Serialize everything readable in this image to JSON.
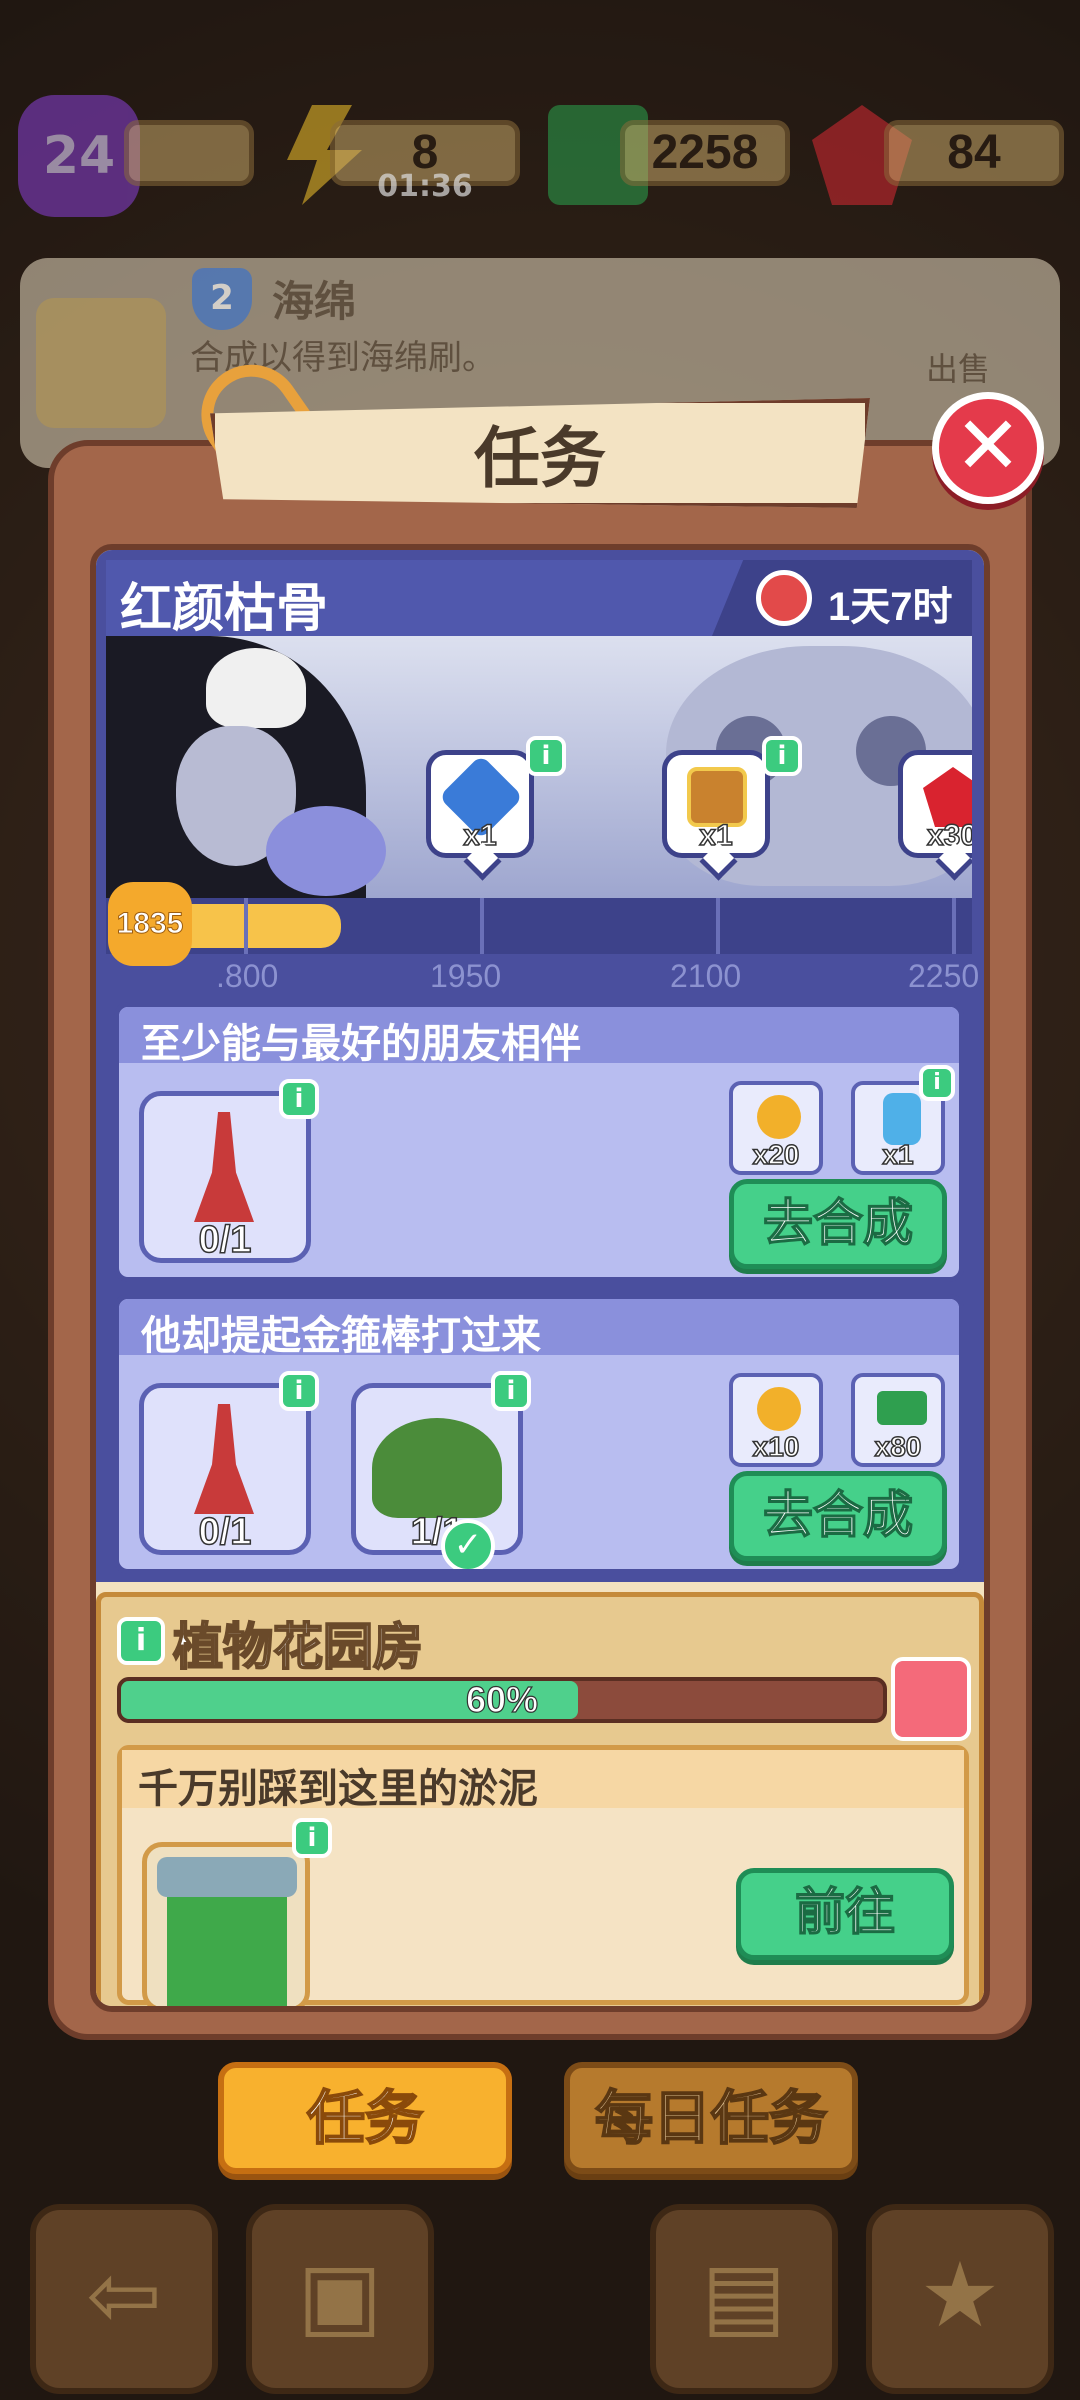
{
  "hud": {
    "level": "24",
    "energy": "8",
    "energy_timer": "01:36",
    "cash": "2258",
    "gems": "84"
  },
  "infocard": {
    "shield_level": "2",
    "item_name": "海绵",
    "description": "合成以得到海绵刷。",
    "sell_label": "出售"
  },
  "modal": {
    "title": "任务",
    "close_glyph": "✕",
    "event": {
      "name": "红颜枯骨",
      "timer": "1天7时",
      "progress": {
        "current_label": "1835",
        "current_value": 1835,
        "ticks": [
          ".800",
          "1950",
          "2100",
          "2250"
        ],
        "rewards": [
          {
            "icon": "hourglass-gem-icon",
            "count": "x1"
          },
          {
            "icon": "treasure-chest-icon",
            "count": "x1"
          },
          {
            "icon": "ruby-icon",
            "count": "x30"
          }
        ]
      },
      "tasks": [
        {
          "title": "至少能与最好的朋友相伴",
          "items": [
            {
              "icon": "brush-icon",
              "count": "0/1"
            }
          ],
          "rewards": [
            {
              "icon": "sunflower-skull-icon",
              "count": "x20"
            },
            {
              "icon": "potion-bottle-icon",
              "count": "x1"
            }
          ],
          "button": "去合成"
        },
        {
          "title": "他却提起金箍棒打过来",
          "items": [
            {
              "icon": "brush-icon",
              "count": "0/1"
            },
            {
              "icon": "flower-pot-icon",
              "count": "1/1"
            }
          ],
          "rewards": [
            {
              "icon": "sunflower-skull-icon",
              "count": "x10"
            },
            {
              "icon": "cash-icon",
              "count": "x80"
            }
          ],
          "button": "去合成"
        }
      ]
    },
    "garden": {
      "name": "植物花园房",
      "progress_label": "60%",
      "progress_value": 0.6,
      "task_title": "千万别踩到这里的淤泥",
      "task_item_icon": "trash-bin-icon",
      "button": "前往"
    }
  },
  "tabs": {
    "active": "任务",
    "inactive": "每日任务"
  },
  "info_glyph": "i",
  "check_glyph": "✓",
  "colors": {
    "accent_green": "#45d08a",
    "event_blue": "#4a4f9e",
    "tab_orange": "#f8b12e",
    "close_red": "#e43a4b"
  }
}
